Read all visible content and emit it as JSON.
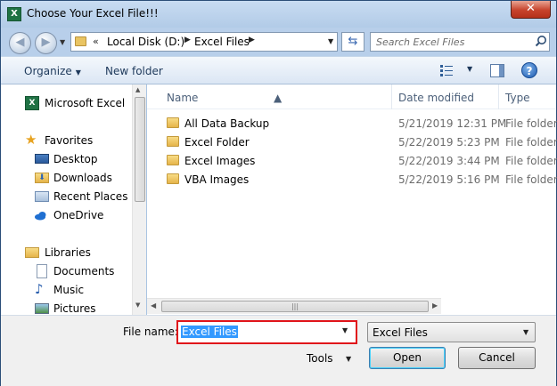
{
  "window": {
    "title": "Choose Your Excel File!!!",
    "app_icon": "X",
    "close_label": "✕"
  },
  "address": {
    "segments": [
      "Local Disk (D:)",
      "Excel Files"
    ],
    "overflow": "«",
    "search_placeholder": "Search Excel Files"
  },
  "toolbar": {
    "organize": "Organize",
    "new_folder": "New folder",
    "help": "?"
  },
  "nav": {
    "items": [
      {
        "label": "Microsoft Excel",
        "icon": "excel-icon"
      },
      {
        "label": "Favorites",
        "icon": "star-icon"
      },
      {
        "label": "Desktop",
        "icon": "desktop-icon"
      },
      {
        "label": "Downloads",
        "icon": "downloads-icon"
      },
      {
        "label": "Recent Places",
        "icon": "recent-places-icon"
      },
      {
        "label": "OneDrive",
        "icon": "onedrive-icon"
      },
      {
        "label": "Libraries",
        "icon": "libraries-icon"
      },
      {
        "label": "Documents",
        "icon": "documents-icon"
      },
      {
        "label": "Music",
        "icon": "music-icon"
      },
      {
        "label": "Pictures",
        "icon": "pictures-icon"
      }
    ]
  },
  "files": {
    "columns": {
      "name": "Name",
      "date": "Date modified",
      "type": "Type"
    },
    "rows": [
      {
        "name": "All Data Backup",
        "date": "5/21/2019 12:31 PM",
        "type": "File folder"
      },
      {
        "name": "Excel Folder",
        "date": "5/22/2019 5:23 PM",
        "type": "File folder"
      },
      {
        "name": "Excel Images",
        "date": "5/22/2019 3:44 PM",
        "type": "File folder"
      },
      {
        "name": "VBA Images",
        "date": "5/22/2019 5:16 PM",
        "type": "File folder"
      }
    ]
  },
  "bottom": {
    "file_name_label": "File name:",
    "file_name_value": "Excel Files",
    "file_type_value": "Excel Files",
    "tools_label": "Tools",
    "open_label": "Open",
    "cancel_label": "Cancel"
  },
  "colors": {
    "highlight_border": "#e0141a",
    "selection": "#3399ff",
    "folder": "#e5b44a"
  }
}
